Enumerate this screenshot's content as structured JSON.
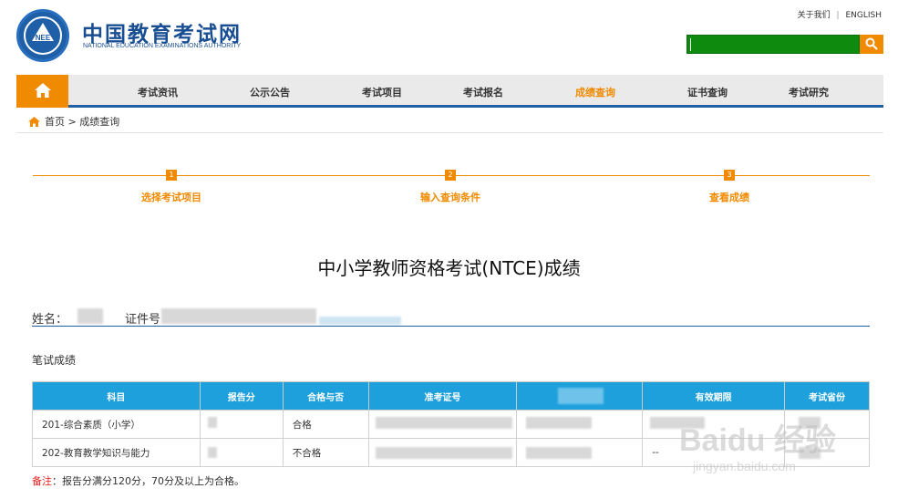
{
  "header": {
    "site_name": "中国教育考试网",
    "site_sub": "NATIONAL EDUCATION EXAMINATIONS AUTHORITY",
    "logo_text": "NEE",
    "top_links": [
      "关于我们",
      "|",
      "ENGLISH"
    ]
  },
  "search": {
    "value": ""
  },
  "nav": {
    "items": [
      "考试资讯",
      "公示公告",
      "考试项目",
      "考试报名",
      "成绩查询",
      "证书查询",
      "考试研究"
    ],
    "active_index": 4
  },
  "breadcrumb": {
    "text": "首页 > 成绩查询"
  },
  "steps": [
    {
      "num": "1",
      "label": "选择考试项目"
    },
    {
      "num": "2",
      "label": "输入查询条件"
    },
    {
      "num": "3",
      "label": "查看成绩"
    }
  ],
  "title": "中小学教师资格考试(NTCE)成绩",
  "info": {
    "name_label": "姓名：",
    "id_label": "证件号"
  },
  "section_label": "笔试成绩",
  "table": {
    "headers": [
      "科目",
      "报告分",
      "合格与否",
      "准考证号",
      "",
      "有效期限",
      "考试省份"
    ],
    "rows": [
      [
        "201-综合素质（小学）",
        "",
        "合格",
        "",
        "",
        "",
        ""
      ],
      [
        "202-教育教学知识与能力",
        "",
        "不合格",
        "",
        "",
        "--",
        ""
      ]
    ]
  },
  "note": {
    "label": "备注",
    "text": "：报告分满分120分，70分及以上为合格。"
  },
  "watermark": {
    "main": "Baidu 经验",
    "sub": "jingyan.baidu.com"
  },
  "colors": {
    "brand_blue": "#1f5fa8",
    "accent_orange": "#f08a00",
    "table_header": "#1ea0dc",
    "search_green": "#0e8a0e"
  }
}
